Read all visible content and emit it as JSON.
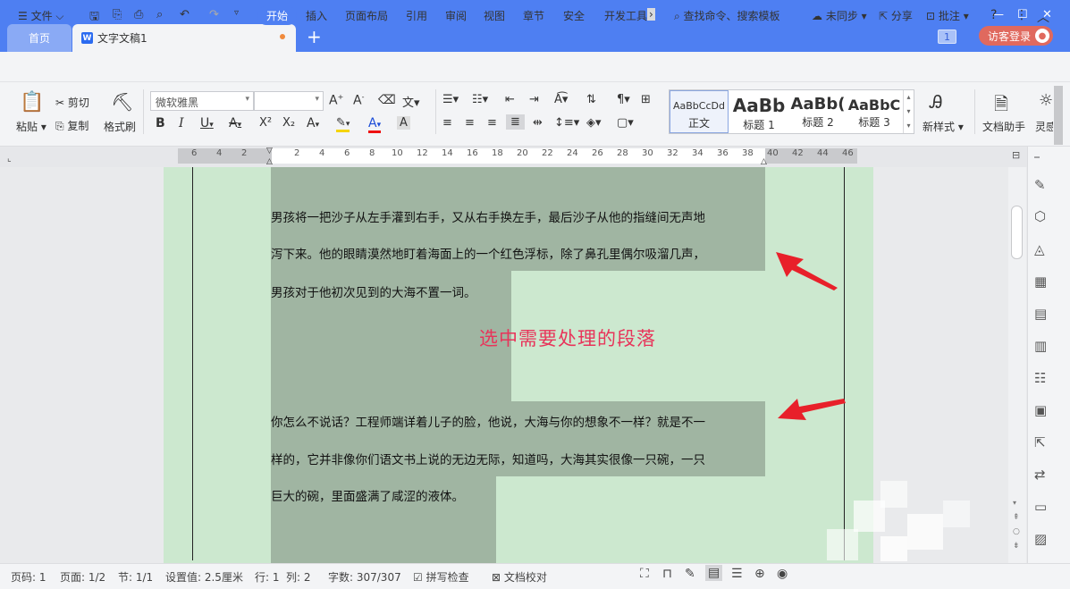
{
  "tabs": {
    "home": "首页",
    "doc": "文字文稿1",
    "page_badge": "1",
    "guest": "访客登录"
  },
  "menu": {
    "file": "文件",
    "items": [
      "开始",
      "插入",
      "页面布局",
      "引用",
      "审阅",
      "视图",
      "章节",
      "安全",
      "开发工具"
    ],
    "search": "查找命令、搜索模板",
    "sync": "未同步",
    "share": "分享",
    "comment": "批注"
  },
  "ribbon": {
    "paste": "粘贴",
    "cut": "剪切",
    "copy": "复制",
    "format_painter": "格式刷",
    "font_name": "微软雅黑",
    "new_style": "新样式",
    "doc_assistant": "文档助手",
    "inspire": "灵感",
    "styles": [
      {
        "preview": "AaBbCcDd",
        "label": "正文"
      },
      {
        "preview": "AaBb",
        "label": "标题 1"
      },
      {
        "preview": "AaBb(",
        "label": "标题 2"
      },
      {
        "preview": "AaBbC",
        "label": "标题 3"
      }
    ]
  },
  "ruler_numbers": [
    "6",
    "4",
    "2",
    "2",
    "4",
    "6",
    "8",
    "10",
    "12",
    "14",
    "16",
    "18",
    "20",
    "22",
    "24",
    "26",
    "28",
    "30",
    "32",
    "34",
    "36",
    "38",
    "40",
    "42",
    "44",
    "46"
  ],
  "document": {
    "para1": [
      "男孩将一把沙子从左手灌到右手，又从右手换左手，最后沙子从他的指缝间无声地",
      "泻下来。他的眼睛漠然地盯着海面上的一个红色浮标，除了鼻孔里偶尔吸溜几声，",
      "男孩对于他初次见到的大海不置一词。"
    ],
    "notice": "选中需要处理的段落",
    "para2": [
      "你怎么不说话？工程师端详着儿子的脸，他说，大海与你的想象不一样？就是不一",
      "样的，它并非像你们语文书上说的无边无际，知道吗，大海其实很像一只碗，一只",
      "巨大的碗，里面盛满了咸涩的液体。"
    ]
  },
  "status": {
    "page_code": "页码: 1",
    "page": "页面: 1/2",
    "section": "节: 1/1",
    "setting": "设置值: 2.5厘米",
    "row": "行: 1",
    "col": "列: 2",
    "words": "字数: 307/307",
    "spell": "拼写检查",
    "proof": "文档校对"
  },
  "colors": {
    "titlebar": "#4e7ff2",
    "page_bg": "#cce8cf",
    "selection": "#a0b5a2",
    "arrow": "#e8202a",
    "notice": "#e8345a"
  },
  "icons": [
    "save-icon",
    "print-icon",
    "undo-icon",
    "redo-icon",
    "search-icon",
    "share-icon",
    "help-icon",
    "more-icon",
    "collapse-icon",
    "bold-icon",
    "italic-icon",
    "underline-icon"
  ]
}
